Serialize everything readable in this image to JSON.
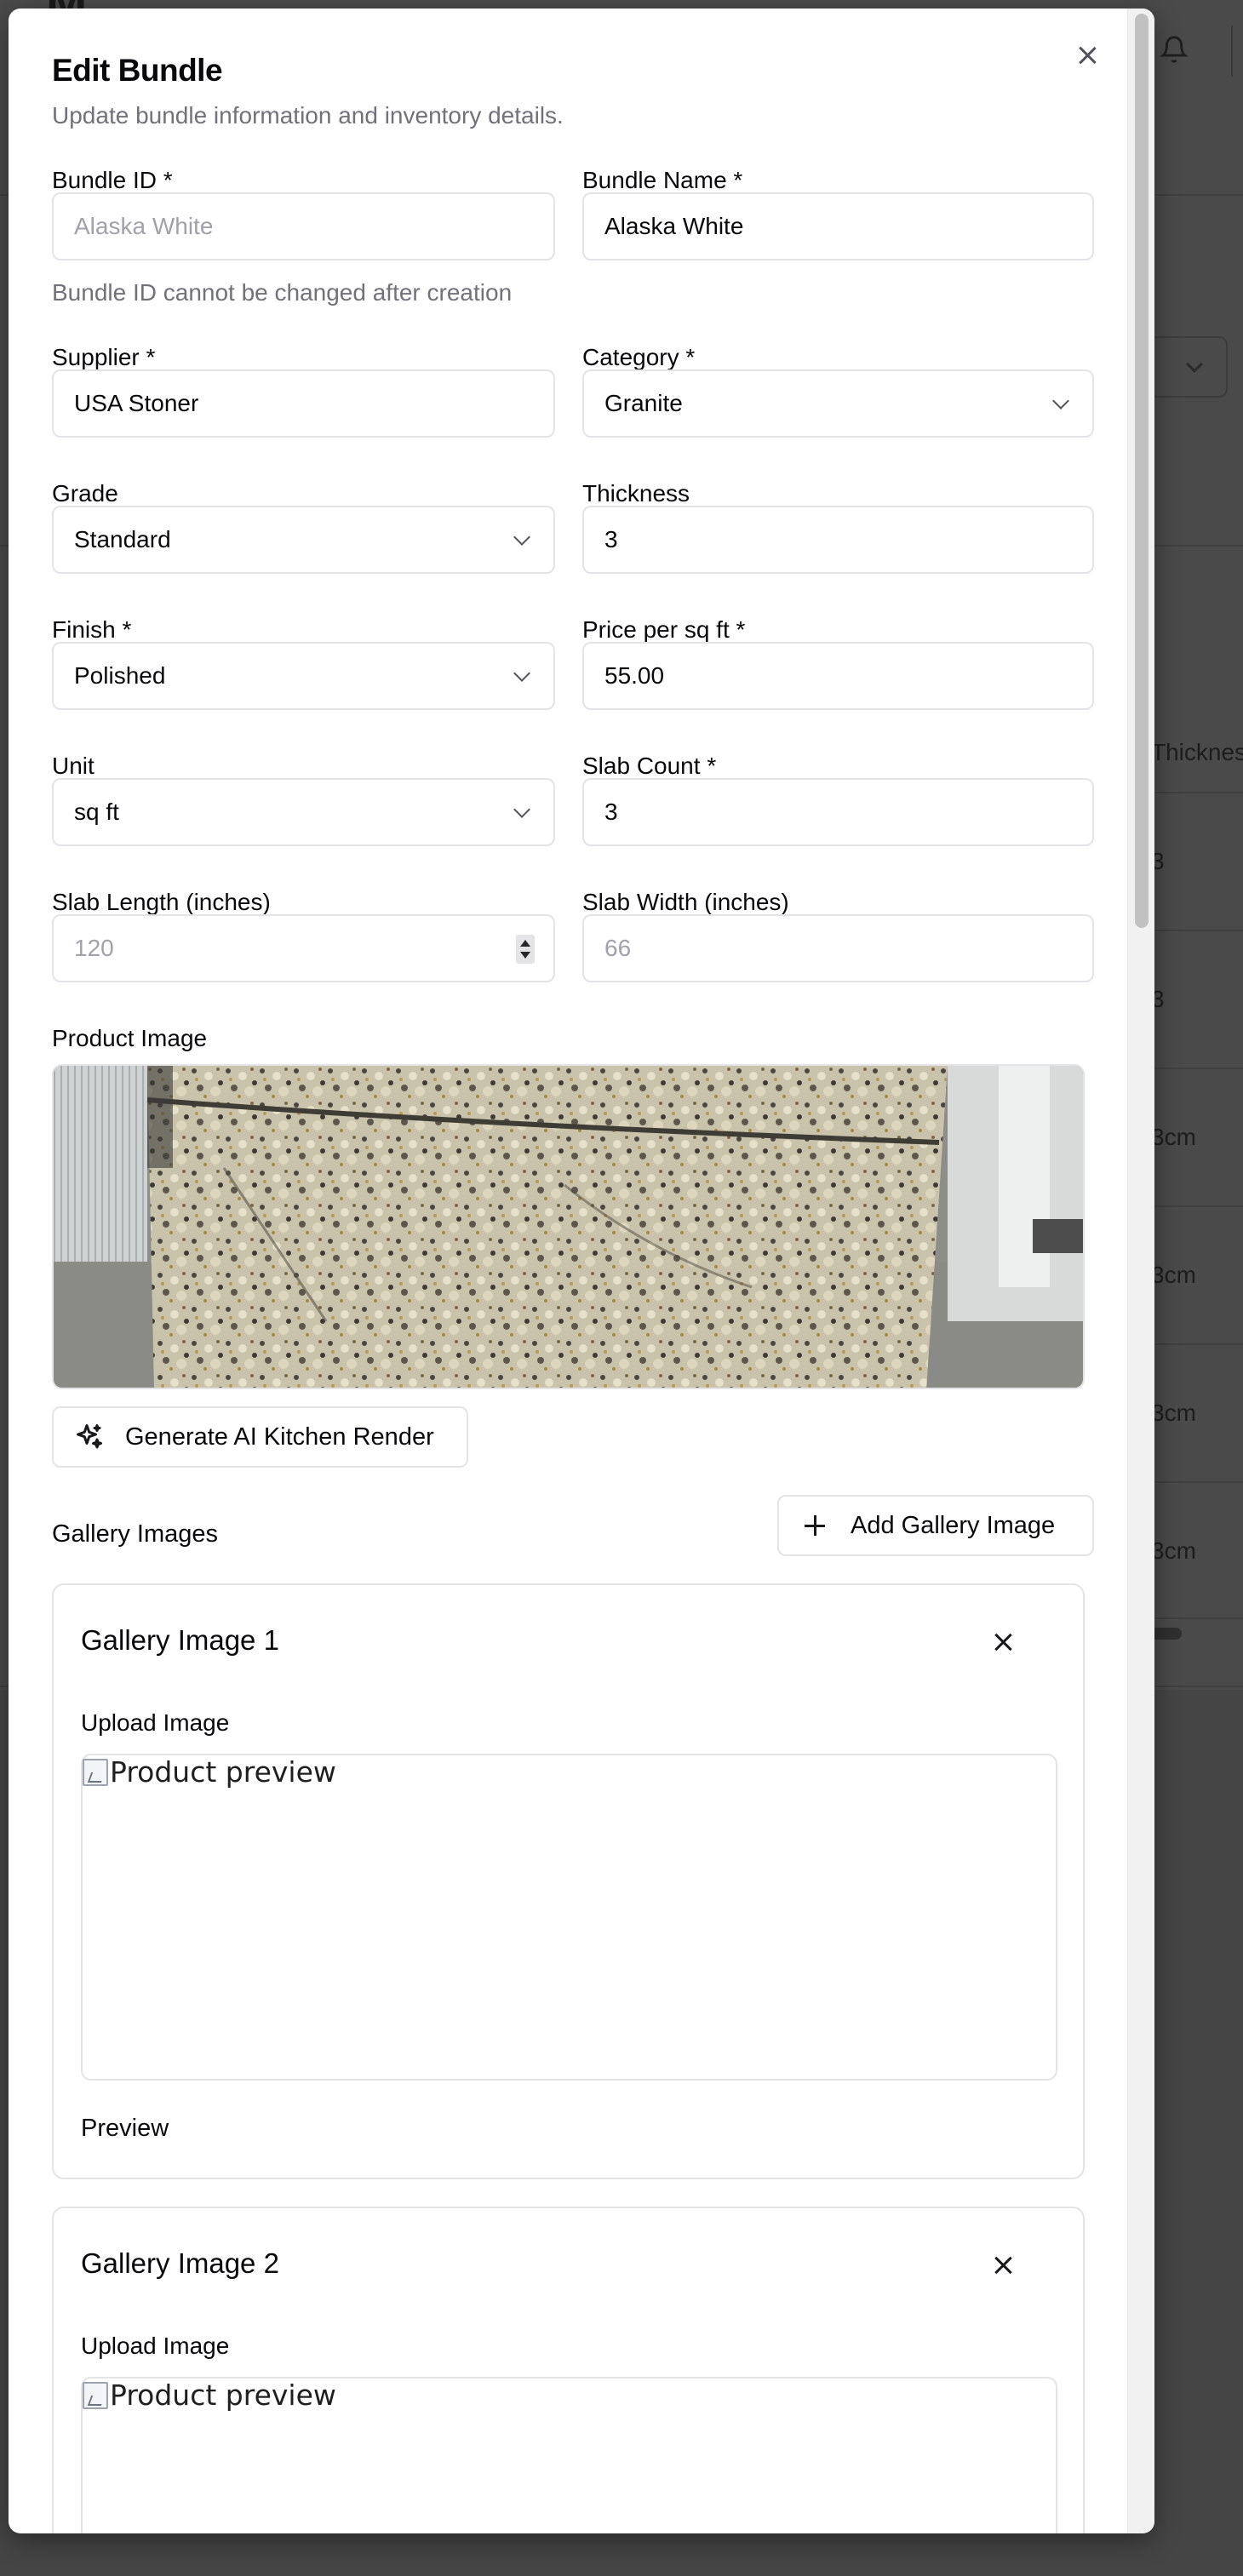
{
  "background": {
    "table_header": "Thicknes",
    "cells": [
      "3",
      "3",
      "3cm",
      "3cm",
      "3cm",
      "3cm"
    ]
  },
  "modal": {
    "title": "Edit Bundle",
    "subtitle": "Update bundle information and inventory details.",
    "fields": {
      "bundle_id": {
        "label": "Bundle ID *",
        "placeholder": "Alaska White",
        "hint": "Bundle ID cannot be changed after creation"
      },
      "bundle_name": {
        "label": "Bundle Name *",
        "value": "Alaska White"
      },
      "supplier": {
        "label": "Supplier *",
        "value": "USA Stoner"
      },
      "category": {
        "label": "Category *",
        "value": "Granite"
      },
      "grade": {
        "label": "Grade",
        "value": "Standard"
      },
      "thickness": {
        "label": "Thickness",
        "value": "3"
      },
      "finish": {
        "label": "Finish *",
        "value": "Polished"
      },
      "price": {
        "label": "Price per sq ft *",
        "value": "55.00"
      },
      "unit": {
        "label": "Unit",
        "value": "sq ft"
      },
      "slab_count": {
        "label": "Slab Count *",
        "value": "3"
      },
      "slab_length": {
        "label": "Slab Length (inches)",
        "placeholder": "120"
      },
      "slab_width": {
        "label": "Slab Width (inches)",
        "placeholder": "66"
      }
    },
    "product_image_label": "Product Image",
    "ai_render_button": "Generate AI Kitchen Render",
    "gallery": {
      "title": "Gallery Images",
      "add_button": "Add Gallery Image",
      "items": [
        {
          "title": "Gallery Image 1",
          "upload_label": "Upload Image",
          "alt": "Product preview",
          "preview_label": "Preview"
        },
        {
          "title": "Gallery Image 2",
          "upload_label": "Upload Image",
          "alt": "Product preview"
        }
      ]
    }
  },
  "colors": {
    "overlay": "#3b3b3b",
    "border": "#e4e4e7",
    "muted_text": "#71717a",
    "text": "#09090b"
  }
}
